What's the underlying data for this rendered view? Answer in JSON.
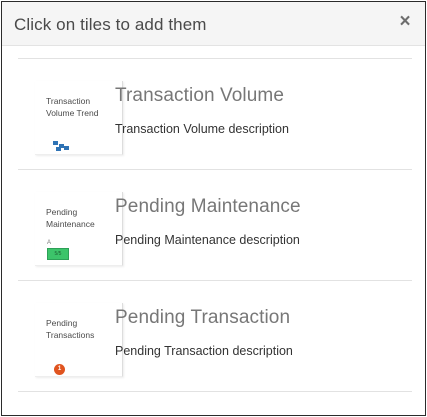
{
  "dialog": {
    "title": "Click on tiles to add them",
    "close_symbol": "×"
  },
  "tiles": [
    {
      "thumb_label": "Transaction Volume Trend",
      "title": "Transaction Volume",
      "description": "Transaction Volume description",
      "thumb_icon": "bar-glyph-icon",
      "accent": "#2f73b5"
    },
    {
      "thumb_label": "Pending Maintenance",
      "title": "Pending Maintenance",
      "description": "Pending Maintenance description",
      "thumb_icon": "green-badge-icon",
      "thumb_small_text": "A",
      "thumb_badge_text": "5/5",
      "accent": "#3cc46a"
    },
    {
      "thumb_label": "Pending Transactions",
      "title": "Pending Transaction",
      "description": "Pending Transaction description",
      "thumb_icon": "orange-dot-icon",
      "thumb_dot_text": "1",
      "accent": "#e0541f"
    }
  ]
}
